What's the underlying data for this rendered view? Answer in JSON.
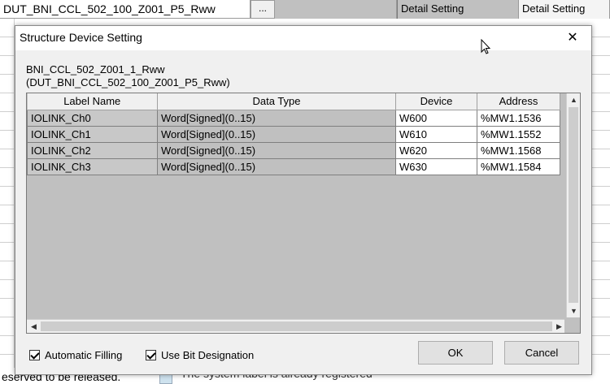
{
  "background": {
    "row_name": "DUT_BNI_CCL_502_100_Z001_P5_Rww",
    "browse_button": "...",
    "detail_setting_1": "Detail Setting",
    "detail_setting_2": "Detail Setting",
    "bottom_left_text": "eserved to be released.",
    "bottom_right_text": "The system label is already registered"
  },
  "dialog": {
    "title": "Structure Device Setting",
    "close_glyph": "✕",
    "struct_label": "BNI_CCL_502_Z001_1_Rww",
    "struct_type": "(DUT_BNI_CCL_502_100_Z001_P5_Rww)",
    "columns": [
      "Label Name",
      "Data Type",
      "Device",
      "Address"
    ],
    "rows": [
      {
        "label": "IOLINK_Ch0",
        "type": "Word[Signed](0..15)",
        "device": "W600",
        "address": "%MW1.1536"
      },
      {
        "label": "IOLINK_Ch1",
        "type": "Word[Signed](0..15)",
        "device": "W610",
        "address": "%MW1.1552"
      },
      {
        "label": "IOLINK_Ch2",
        "type": "Word[Signed](0..15)",
        "device": "W620",
        "address": "%MW1.1568"
      },
      {
        "label": "IOLINK_Ch3",
        "type": "Word[Signed](0..15)",
        "device": "W630",
        "address": "%MW1.1584"
      }
    ],
    "auto_filling": {
      "label": "Automatic Filling",
      "checked": true
    },
    "bit_designation": {
      "label": "Use Bit Designation",
      "checked": true
    },
    "ok_label": "OK",
    "cancel_label": "Cancel"
  }
}
